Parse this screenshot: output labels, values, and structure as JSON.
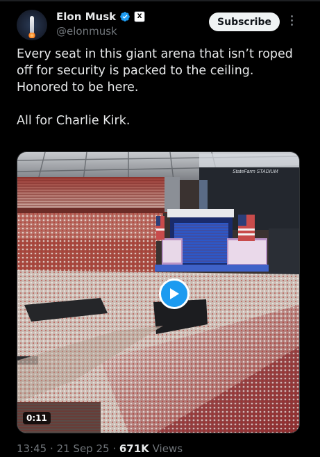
{
  "author": {
    "name": "Elon Musk",
    "handle": "@elonmusk",
    "affiliation_badge": "X",
    "verified_color": "#1d9bf0"
  },
  "actions": {
    "subscribe_label": "Subscribe",
    "more_icon": "more-vertical-icon"
  },
  "tweet": {
    "paragraph1": "Every seat in this giant arena that isn’t roped off for security is packed to the ceiling. Honored to be here.",
    "paragraph2": "All for Charlie Kirk."
  },
  "video": {
    "duration": "0:11",
    "venue_sign": "StateFarm STADIUM",
    "play_icon": "play-icon"
  },
  "meta": {
    "time": "13:45",
    "date": "21 Sep 25",
    "views_count": "671K",
    "views_label": "Views"
  },
  "colors": {
    "background": "#000000",
    "text": "#e7e9ea",
    "muted": "#71767b",
    "accent": "#1d9bf0"
  }
}
